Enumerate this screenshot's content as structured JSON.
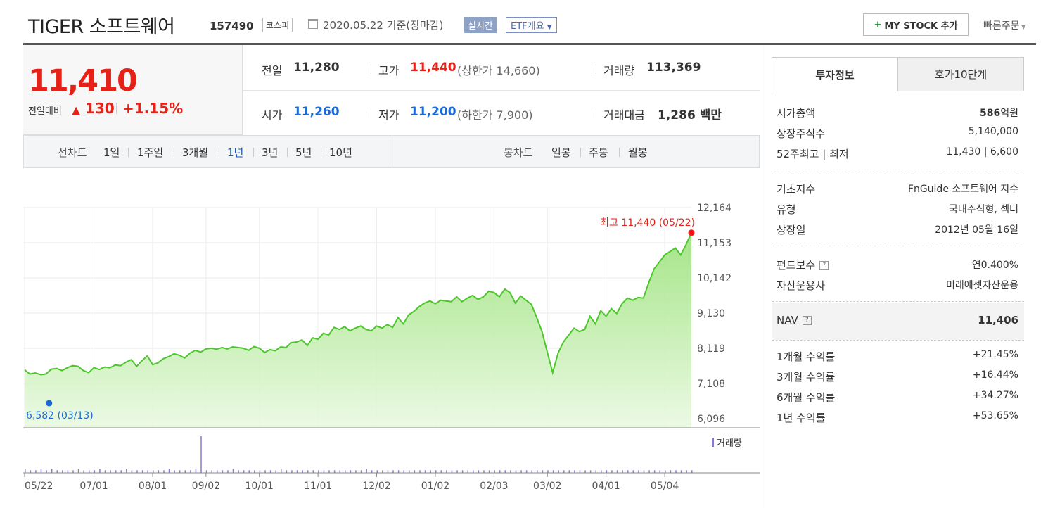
{
  "header": {
    "title": "TIGER 소프트웨어",
    "code": "157490",
    "market": "코스피",
    "date": "2020.05.22 기준(장마감)",
    "realtime": "실시간",
    "etf_overview": "ETF개요",
    "my_stock": "MY STOCK 추가",
    "quick_order": "빠른주문"
  },
  "price": {
    "current": "11,410",
    "change_label": "전일대비",
    "change": "130",
    "change_pct": "+1.15%"
  },
  "stats": {
    "prev_close_label": "전일",
    "prev_close": "11,280",
    "high_label": "고가",
    "high": "11,440",
    "upper_limit": "(상한가 14,660)",
    "volume_label": "거래량",
    "volume": "113,369",
    "open_label": "시가",
    "open": "11,260",
    "low_label": "저가",
    "low": "11,200",
    "lower_limit": "(하한가 7,900)",
    "value_label": "거래대금",
    "value": "1,286 백만"
  },
  "tabs": {
    "line_label": "선차트",
    "line_periods": [
      "1일",
      "1주일",
      "3개월",
      "1년",
      "3년",
      "5년",
      "10년"
    ],
    "active": "1년",
    "candle_label": "봉차트",
    "candle_periods": [
      "일봉",
      "주봉",
      "월봉"
    ]
  },
  "chart_data": {
    "type": "area",
    "x_ticks": [
      "05/22",
      "07/01",
      "08/01",
      "09/02",
      "10/01",
      "11/01",
      "12/02",
      "01/02",
      "02/03",
      "03/02",
      "04/01",
      "05/04"
    ],
    "y_ticks": [
      "12,164",
      "11,153",
      "10,142",
      "9,130",
      "8,119",
      "7,108",
      "6,096"
    ],
    "ylim": [
      6096,
      12164
    ],
    "max_annotation": "최고 11,440 (05/22)",
    "min_annotation": "최저 6,582 (03/13)",
    "volume_label": "거래량",
    "series": [
      {
        "values": [
          7500,
          7380,
          7410,
          7360,
          7380,
          7520,
          7540,
          7480,
          7560,
          7620,
          7600,
          7480,
          7420,
          7560,
          7510,
          7580,
          7560,
          7640,
          7620,
          7720,
          7790,
          7600,
          7760,
          7900,
          7650,
          7700,
          7820,
          7880,
          7960,
          7920,
          7840,
          7980,
          8060,
          8010,
          8100,
          8120,
          8090,
          8140,
          8100,
          8160,
          8140,
          8120,
          8060,
          8170,
          8120,
          8000,
          8080,
          8050,
          8160,
          8140,
          8280,
          8300,
          8360,
          8200,
          8420,
          8380,
          8550,
          8500,
          8720,
          8660,
          8740,
          8620,
          8700,
          8760,
          8660,
          8620,
          8760,
          8700,
          8800,
          8720,
          9000,
          8820,
          9080,
          9180,
          9320,
          9420,
          9480,
          9400,
          9500,
          9480,
          9460,
          9600,
          9460,
          9560,
          9640,
          9520,
          9600,
          9760,
          9720,
          9600,
          9820,
          9720,
          9420,
          9620,
          9500,
          9380,
          9000,
          8600,
          8000,
          7420,
          7980,
          8300,
          8500,
          8700,
          8600,
          8660,
          9040,
          8820,
          9200,
          9040,
          9260,
          9120,
          9400,
          9560,
          9500,
          9580,
          9560,
          10000,
          10400,
          10600,
          10800,
          10900,
          11000,
          10800,
          11100,
          11440
        ]
      }
    ],
    "volume": [
      3,
      2,
      2,
      3,
      2,
      3,
      2,
      2,
      2,
      2,
      3,
      2,
      2,
      2,
      3,
      2,
      2,
      2,
      2,
      3,
      2,
      2,
      2,
      2,
      2,
      2,
      2,
      3,
      2,
      2,
      2,
      2,
      3,
      28,
      2,
      2,
      2,
      2,
      2,
      3,
      2,
      2,
      2,
      2,
      2,
      2,
      2,
      2,
      3,
      2,
      2,
      2,
      2,
      2,
      2,
      2,
      2,
      2,
      2,
      2,
      2,
      2,
      2,
      2,
      3,
      2,
      2,
      2,
      2,
      2,
      2,
      2,
      2,
      2,
      2,
      2,
      2,
      2,
      2,
      2,
      2,
      2,
      2,
      2,
      2,
      2,
      2,
      2,
      2,
      2,
      2,
      2,
      2,
      2,
      2,
      2,
      2,
      2,
      2,
      2,
      2,
      2,
      2,
      2,
      2,
      2,
      2,
      2,
      2,
      2,
      2,
      2,
      2,
      2,
      2,
      2,
      2,
      2,
      2,
      2,
      2,
      2,
      2,
      2,
      2,
      2
    ]
  },
  "info": {
    "tab_invest": "투자정보",
    "tab_quote": "호가10단계",
    "market_cap_label": "시가총액",
    "market_cap_num": "586",
    "market_cap_unit": "억원",
    "shares_label": "상장주식수",
    "shares": "5,140,000",
    "week52_label": "52주최고 | 최저",
    "week52": "11,430 | 6,600",
    "index_label": "기초지수",
    "index": "FnGuide 소프트웨어 지수",
    "type_label": "유형",
    "type": "국내주식형, 섹터",
    "listing_label": "상장일",
    "listing": "2012년 05월 16일",
    "fee_label": "펀드보수",
    "fee": "연0.400%",
    "manager_label": "자산운용사",
    "manager": "미래에셋자산운용",
    "nav_label": "NAV",
    "nav": "11,406",
    "r1m_label": "1개월 수익률",
    "r1m": "+21.45%",
    "r3m_label": "3개월 수익률",
    "r3m": "+16.44%",
    "r6m_label": "6개월 수익률",
    "r6m": "+34.27%",
    "r1y_label": "1년 수익률",
    "r1y": "+53.65%"
  }
}
